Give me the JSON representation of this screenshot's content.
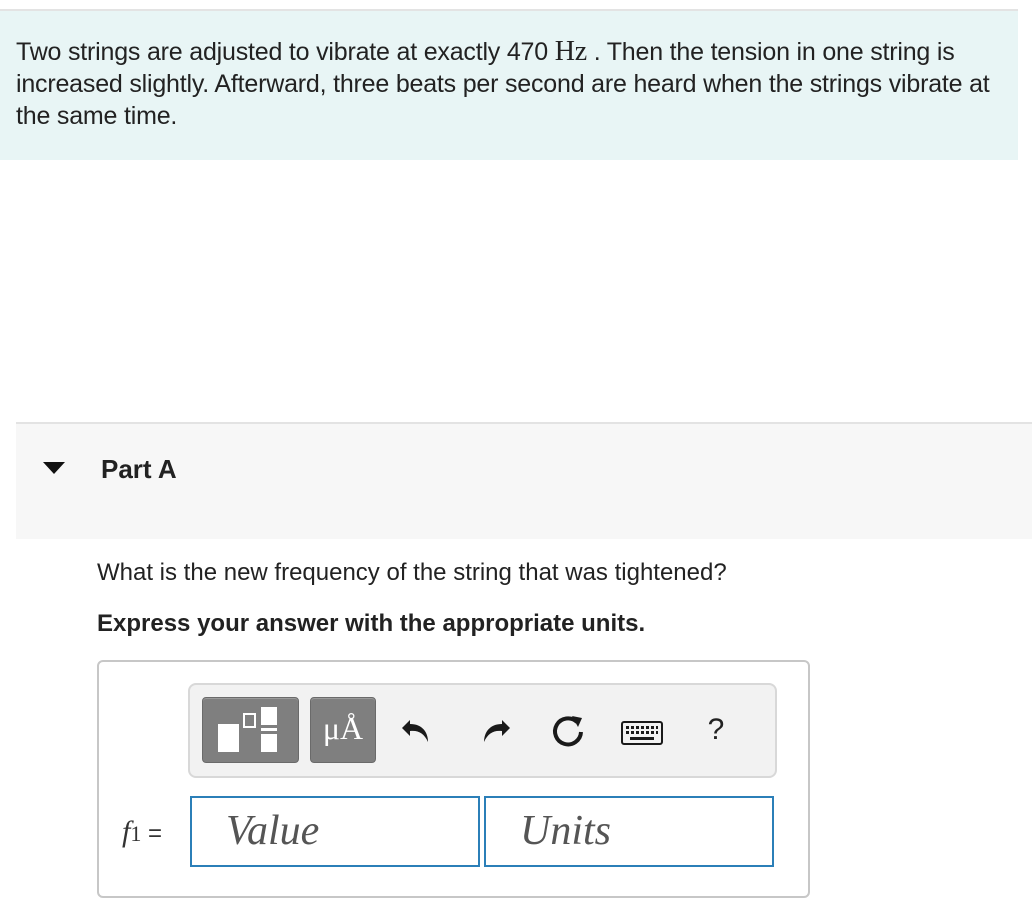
{
  "problem": {
    "text_before_unit": "Two strings are adjusted to vibrate at exactly 470 ",
    "unit": "Hz",
    "text_after_unit": " . Then the tension in one string is increased slightly. Afterward, three beats per second are heard when the strings vibrate at the same time."
  },
  "part": {
    "title": "Part A",
    "question": "What is the new frequency of the string that was tightened?",
    "instruction": "Express your answer with the appropriate units."
  },
  "toolbar": {
    "templates_icon": "templates-icon",
    "units_label": "μÅ",
    "undo_icon": "undo-arrow-icon",
    "redo_icon": "redo-arrow-icon",
    "reset_icon": "reset-circular-arrow-icon",
    "keyboard_icon": "keyboard-icon",
    "help_label": "?"
  },
  "answer": {
    "variable": "f",
    "subscript": "1",
    "equals": "=",
    "value_placeholder": "Value",
    "units_placeholder": "Units"
  },
  "colors": {
    "problem_background": "#e8f5f5",
    "part_header_background": "#f7f7f7",
    "field_border": "#2b7fb8",
    "toolbar_button": "#7f7f7f"
  }
}
